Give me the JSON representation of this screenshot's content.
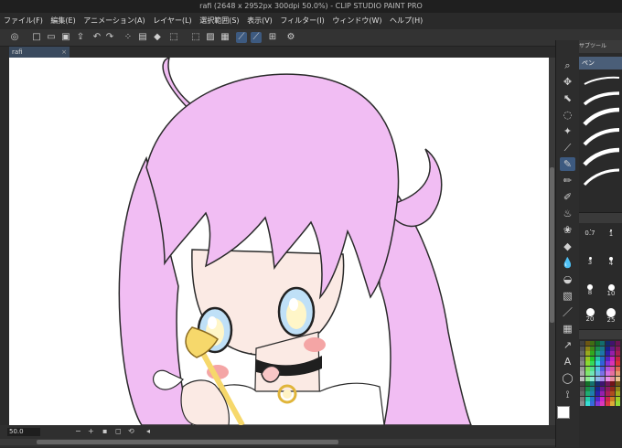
{
  "window": {
    "title": "rafi (2648 x 2952px 300dpi 50.0%)  - CLIP STUDIO PAINT PRO"
  },
  "menu": {
    "items": [
      "ファイル(F)",
      "編集(E)",
      "アニメーション(A)",
      "レイヤー(L)",
      "選択範囲(S)",
      "表示(V)",
      "フィルター(I)",
      "ウィンドウ(W)",
      "ヘルプ(H)"
    ]
  },
  "document": {
    "tab_label": "rafi",
    "tab_close": "×"
  },
  "status": {
    "zoom": "50.0",
    "minus": "−",
    "plus": "+"
  },
  "subtool_panel": {
    "header": "サブツール",
    "active_tab": "ペン"
  },
  "brush_sizes": [
    "0.7",
    "1",
    "3",
    "4",
    "8",
    "10",
    "20",
    "25"
  ],
  "colors": {
    "accent": "#3d5a80",
    "hair": "#f1bdf3",
    "skin": "#fbeae4",
    "eye": "#bfe0f7",
    "ribbon": "#1f1f1f",
    "gold": "#f6d86b"
  },
  "icons": {
    "tools": [
      "magnifier-icon",
      "move-icon",
      "operation-icon",
      "lasso-icon",
      "magic-wand-icon",
      "eyedropper-icon",
      "pen-icon",
      "pencil-icon",
      "brush-icon",
      "airbrush-icon",
      "decoration-icon",
      "eraser-icon",
      "blend-icon",
      "fill-icon",
      "gradient-icon",
      "figure-icon",
      "frame-icon",
      "ruler-icon",
      "text-icon",
      "balloon-icon",
      "line-fix-icon"
    ]
  }
}
